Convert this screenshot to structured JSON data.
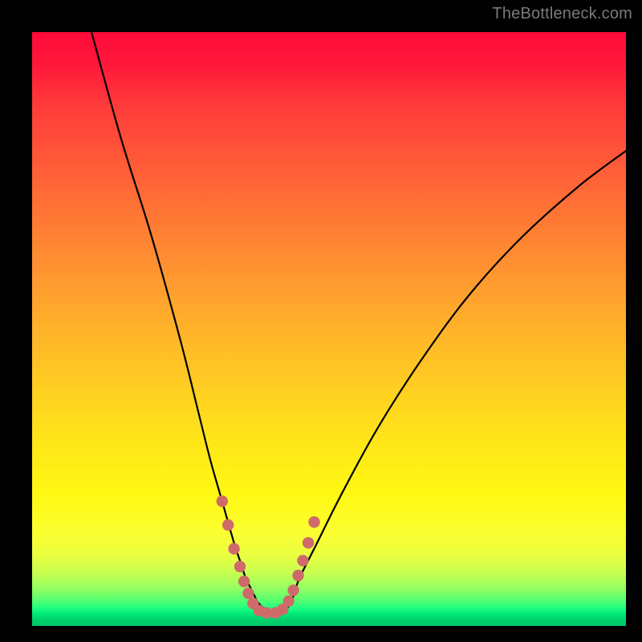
{
  "watermark": "TheBottleneck.com",
  "colors": {
    "frame": "#000000",
    "curve": "#000000",
    "marker": "#cf6a6a",
    "gradient_top": "#ff0a3a",
    "gradient_bottom": "#00c862"
  },
  "chart_data": {
    "type": "line",
    "title": "",
    "xlabel": "",
    "ylabel": "",
    "xlim": [
      0,
      100
    ],
    "ylim": [
      0,
      100
    ],
    "grid": false,
    "legend": null,
    "series": [
      {
        "name": "bottleneck-curve",
        "x": [
          10,
          15,
          20,
          25,
          28,
          30,
          32,
          34,
          35,
          36,
          37,
          38,
          39,
          40,
          41,
          42,
          43,
          44,
          45,
          48,
          52,
          58,
          65,
          73,
          82,
          92,
          100
        ],
        "y": [
          100,
          82,
          66,
          48,
          36,
          28,
          21,
          14,
          11,
          8,
          6,
          4,
          3,
          2,
          2,
          2,
          3,
          5,
          8,
          14,
          22,
          33,
          44,
          55,
          65,
          74,
          80
        ]
      }
    ],
    "markers": [
      {
        "x": 32.0,
        "y": 21
      },
      {
        "x": 33.0,
        "y": 17
      },
      {
        "x": 34.0,
        "y": 13
      },
      {
        "x": 35.0,
        "y": 10
      },
      {
        "x": 35.7,
        "y": 7.5
      },
      {
        "x": 36.4,
        "y": 5.5
      },
      {
        "x": 37.2,
        "y": 3.8
      },
      {
        "x": 38.2,
        "y": 2.6
      },
      {
        "x": 39.5,
        "y": 2.2
      },
      {
        "x": 41.0,
        "y": 2.2
      },
      {
        "x": 42.2,
        "y": 2.8
      },
      {
        "x": 43.2,
        "y": 4.2
      },
      {
        "x": 44.0,
        "y": 6.0
      },
      {
        "x": 44.8,
        "y": 8.5
      },
      {
        "x": 45.6,
        "y": 11.0
      },
      {
        "x": 46.5,
        "y": 14.0
      },
      {
        "x": 47.5,
        "y": 17.5
      }
    ]
  }
}
